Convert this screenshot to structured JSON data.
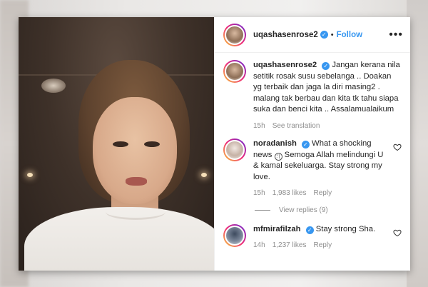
{
  "post": {
    "author": "uqashasenrose2",
    "follow_label": "Follow",
    "more_label": "•••",
    "caption": {
      "username": "uqashasenrose2",
      "text": "Jangan kerana nila setitik rosak susu sebelanga .. Doakan yg terbaik dan jaga la diri masing2 . malang tak berbau dan kita tk tahu siapa suka dan benci kita .. Assalamualaikum",
      "time": "15h",
      "translate_label": "See translation"
    },
    "comments": [
      {
        "username": "noradanish",
        "text_before": "What a shocking news",
        "text_after": "Semoga Allah melindungi U & kamal sekeluarga. Stay strong my love.",
        "time": "15h",
        "likes": "1,983 likes",
        "reply_label": "Reply",
        "view_replies_label": "View replies (9)"
      },
      {
        "username": "mfmirafilzah",
        "text": "Stay strong Sha.",
        "time": "14h",
        "likes": "1,237 likes",
        "reply_label": "Reply"
      }
    ]
  },
  "colors": {
    "accent": "#3897f0",
    "text": "#262626",
    "muted": "#8e8e8e"
  },
  "icons": {
    "verified": "verified-badge-icon",
    "heart": "heart-icon",
    "emoji": "crying-face-icon"
  }
}
